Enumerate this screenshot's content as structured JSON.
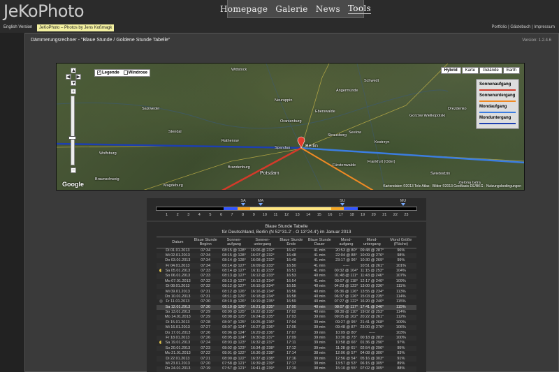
{
  "site": {
    "logo": "JeKoPhoto"
  },
  "nav": {
    "items": [
      {
        "label": "Homepage"
      },
      {
        "label": "Galerie"
      },
      {
        "label": "News"
      },
      {
        "label": "Tools"
      }
    ]
  },
  "subnav": {
    "english": "English Version",
    "tagline": "JeKoPhoto – Photos by Jens Koßmagk",
    "right": "Portfolio | Gästebuch | Impressum"
  },
  "page": {
    "title": "Dämmerungsrechner - \"Blaue Stunde / Goldene Stunde Tabelle\"",
    "version": "Version: 1.2.4.6"
  },
  "map": {
    "legend_toggle": "Legende",
    "windrose_toggle": "Windrose",
    "map_types": [
      "Hybrid",
      "Karte",
      "Gelände",
      "Earth"
    ],
    "active_type": "Hybrid",
    "legend": [
      {
        "label": "Sonnenaufgang",
        "color": "#d43a2a"
      },
      {
        "label": "Sonnenuntergang",
        "color": "#f08a24"
      },
      {
        "label": "Mondaufgang",
        "color": "#3b7de0"
      },
      {
        "label": "Monduntergang",
        "color": "#1d3fb0"
      }
    ],
    "google": "Google",
    "copyright": "Kartendaten ©2013 Tele Atlas · Bilder ©2013 GeoBasis-DE/BKG · Nutzungsbedingungen",
    "places": [
      {
        "name": "Wittstock"
      },
      {
        "name": "Neuruppin"
      },
      {
        "name": "Salzwedel"
      },
      {
        "name": "Stendal"
      },
      {
        "name": "Wolfsburg"
      },
      {
        "name": "Braunschweig"
      },
      {
        "name": "Magdeburg"
      },
      {
        "name": "Brandenburg"
      },
      {
        "name": "Potsdam"
      },
      {
        "name": "Berlin"
      },
      {
        "name": "Eberswalde"
      },
      {
        "name": "Schwedt"
      },
      {
        "name": "Gorzów Wielkopolski"
      },
      {
        "name": "Frankfurt (Oder)"
      },
      {
        "name": "Oranienburg"
      },
      {
        "name": "Rathenow"
      },
      {
        "name": "Spandau"
      },
      {
        "name": "Angermünde"
      },
      {
        "name": "Drezdenko"
      },
      {
        "name": "Świebodzin"
      },
      {
        "name": "Zielona Góra"
      },
      {
        "name": "Kostrzyn"
      },
      {
        "name": "Seelow"
      },
      {
        "name": "Strausberg"
      },
      {
        "name": "Fürstenwalde"
      }
    ]
  },
  "timeline": {
    "hours": [
      "1",
      "2",
      "3",
      "4",
      "5",
      "6",
      "7",
      "8",
      "9",
      "10",
      "11",
      "12",
      "13",
      "14",
      "15",
      "16",
      "17",
      "18",
      "19",
      "20",
      "21",
      "22",
      "23"
    ],
    "events": [
      {
        "label": "SA"
      },
      {
        "label": "MA"
      },
      {
        "label": "SU"
      },
      {
        "label": "MU"
      }
    ]
  },
  "table": {
    "title": "Blaue Stunde Tabelle",
    "subtitle": "für Deutschland, Berlin (N 52°31.2' - O 13°24.4') im Januar 2013",
    "headers": [
      "",
      "Datum",
      "Blaue Stunde Beginn",
      "Sonnen-aufgang",
      "Sonnen-untergang",
      "Blaue Stunde Ende",
      "Blaue Stunde Dauer",
      "Mond-aufgang",
      "Mond-untergang",
      "Mond Größe (Fläche)"
    ],
    "rows": [
      {
        "m": "",
        "d": "Di 01.01.2013",
        "b": "07:34",
        "sa": "08:15 @ 128°",
        "su": "16:06 @ 232°",
        "e": "16:47",
        "du": "41 min",
        "ma": "20:53 @ 80°",
        "mu": "09:48 @ 287°",
        "g": "96%"
      },
      {
        "m": "",
        "d": "Mi 02.01.2013",
        "b": "07:34",
        "sa": "08:15 @ 128°",
        "su": "16:07 @ 232°",
        "e": "16:48",
        "du": "41 min",
        "ma": "22:04 @ 88°",
        "mu": "10:09 @ 276°",
        "g": "98%"
      },
      {
        "m": "",
        "d": "Do 03.01.2013",
        "b": "07:34",
        "sa": "08:14 @ 128°",
        "su": "16:08 @ 232°",
        "e": "16:49",
        "du": "41 min",
        "ma": "23:17 @ 96°",
        "mu": "10:30 @ 269°",
        "g": "99%"
      },
      {
        "m": "",
        "d": "Fr 04.01.2013",
        "b": "07:34",
        "sa": "08:14 @ 127°",
        "su": "16:09 @ 233°",
        "e": "16:50",
        "du": "41 min",
        "ma": "-----",
        "mu": "10:51 @ 261°",
        "g": "101%"
      },
      {
        "m": "half",
        "d": "Sa 05.01.2013",
        "b": "07:33",
        "sa": "08:14 @ 127°",
        "su": "16:11 @ 233°",
        "e": "16:51",
        "du": "41 min",
        "ma": "00:32 @ 104°",
        "mu": "11:15 @ 253°",
        "g": "104%"
      },
      {
        "m": "",
        "d": "So 06.01.2013",
        "b": "07:33",
        "sa": "08:13 @ 127°",
        "su": "16:12 @ 233°",
        "e": "16:53",
        "du": "40 min",
        "ma": "01:48 @ 111°",
        "mu": "11:43 @ 246°",
        "g": "107%"
      },
      {
        "m": "",
        "d": "Mo 07.01.2013",
        "b": "07:32",
        "sa": "08:13 @ 127°",
        "su": "16:13 @ 234°",
        "e": "16:54",
        "du": "41 min",
        "ma": "03:07 @ 118°",
        "mu": "12:17 @ 240°",
        "g": "109%"
      },
      {
        "m": "",
        "d": "Di 08.01.2013",
        "b": "07:32",
        "sa": "08:12 @ 127°",
        "su": "16:15 @ 234°",
        "e": "16:55",
        "du": "40 min",
        "ma": "04:23 @ 123°",
        "mu": "13:00 @ 236°",
        "g": "111%"
      },
      {
        "m": "",
        "d": "Mi 09.01.2013",
        "b": "07:31",
        "sa": "08:12 @ 126°",
        "su": "16:16 @ 234°",
        "e": "16:56",
        "du": "40 min",
        "ma": "05:36 @ 126°",
        "mu": "13:55 @ 234°",
        "g": "113%"
      },
      {
        "m": "",
        "d": "Do 10.01.2013",
        "b": "07:31",
        "sa": "08:11 @ 126°",
        "su": "16:18 @ 234°",
        "e": "16:58",
        "du": "40 min",
        "ma": "06:37 @ 126°",
        "mu": "15:03 @ 235°",
        "g": "114%"
      },
      {
        "m": "new",
        "d": "Fr 11.01.2013",
        "b": "07:30",
        "sa": "08:10 @ 126°",
        "su": "16:19 @ 235°",
        "e": "16:59",
        "du": "40 min",
        "ma": "07:27 @ 122°",
        "mu": "16:20 @ 240°",
        "g": "115%"
      },
      {
        "m": "",
        "d": "Sa 12.01.2013",
        "b": "07:30",
        "sa": "08:10 @ 126°",
        "su": "16:21 @ 235°",
        "e": "17:00",
        "du": "40 min",
        "ma": "08:07 @ 117°",
        "mu": "17:41 @ 246°",
        "g": "115%",
        "hl": true
      },
      {
        "m": "",
        "d": "So 13.01.2013",
        "b": "07:29",
        "sa": "08:09 @ 125°",
        "su": "16:22 @ 235°",
        "e": "17:02",
        "du": "40 min",
        "ma": "08:39 @ 110°",
        "mu": "19:02 @ 253°",
        "g": "114%"
      },
      {
        "m": "",
        "d": "Mo 14.01.2013",
        "b": "07:29",
        "sa": "08:08 @ 125°",
        "su": "16:24 @ 235°",
        "e": "17:03",
        "du": "39 min",
        "ma": "09:05 @ 102°",
        "mu": "20:22 @ 261°",
        "g": "112%"
      },
      {
        "m": "",
        "d": "Di 15.01.2013",
        "b": "07:28",
        "sa": "08:07 @ 125°",
        "su": "16:25 @ 236°",
        "e": "17:04",
        "du": "39 min",
        "ma": "09:27 @ 95°",
        "mu": "21:41 @ 268°",
        "g": "109%"
      },
      {
        "m": "",
        "d": "Mi 16.01.2013",
        "b": "07:27",
        "sa": "08:07 @ 124°",
        "su": "16:27 @ 236°",
        "e": "17:06",
        "du": "39 min",
        "ma": "09:48 @ 87°",
        "mu": "23:00 @ 276°",
        "g": "106%"
      },
      {
        "m": "",
        "d": "Do 17.01.2013",
        "b": "07:26",
        "sa": "08:06 @ 124°",
        "su": "16:29 @ 236°",
        "e": "17:07",
        "du": "39 min",
        "ma": "10:09 @ 80°",
        "mu": "-----",
        "g": "103%"
      },
      {
        "m": "",
        "d": "Fr 18.01.2013",
        "b": "07:26",
        "sa": "08:05 @ 124°",
        "su": "16:30 @ 237°",
        "e": "17:09",
        "du": "39 min",
        "ma": "10:30 @ 73°",
        "mu": "00:18 @ 283°",
        "g": "100%"
      },
      {
        "m": "half",
        "d": "Sa 19.01.2013",
        "b": "07:24",
        "sa": "08:03 @ 123°",
        "su": "16:32 @ 237°",
        "e": "17:11",
        "du": "39 min",
        "ma": "10:58 @ 66°",
        "mu": "01:36 @ 290°",
        "g": "97%"
      },
      {
        "m": "",
        "d": "So 20.01.2013",
        "b": "07:23",
        "sa": "08:02 @ 123°",
        "su": "16:34 @ 238°",
        "e": "17:12",
        "du": "39 min",
        "ma": "11:28 @ 61°",
        "mu": "02:54 @ 296°",
        "g": "95%"
      },
      {
        "m": "",
        "d": "Mo 21.01.2013",
        "b": "07:22",
        "sa": "08:01 @ 122°",
        "su": "16:36 @ 238°",
        "e": "17:14",
        "du": "38 min",
        "ma": "12:06 @ 57°",
        "mu": "04:08 @ 300°",
        "g": "93%"
      },
      {
        "m": "",
        "d": "Di 22.01.2013",
        "b": "07:21",
        "sa": "08:00 @ 122°",
        "su": "16:37 @ 238°",
        "e": "17:16",
        "du": "39 min",
        "ma": "12:56 @ 54°",
        "mu": "05:16 @ 303°",
        "g": "91%"
      },
      {
        "m": "",
        "d": "Mi 23.01.2013",
        "b": "07:20",
        "sa": "07:58 @ 121°",
        "su": "16:39 @ 239°",
        "e": "17:17",
        "du": "38 min",
        "ma": "13:57 @ 53°",
        "mu": "06:15 @ 305°",
        "g": "89%"
      },
      {
        "m": "",
        "d": "Do 24.01.2013",
        "b": "07:19",
        "sa": "07:57 @ 121°",
        "su": "16:41 @ 239°",
        "e": "17:19",
        "du": "38 min",
        "ma": "15:10 @ 55°",
        "mu": "07:02 @ 305°",
        "g": "88%"
      },
      {
        "m": "",
        "d": "Fr 25.01.2013",
        "b": "07:18",
        "sa": "07:56 @ 120°",
        "su": "16:43 @ 240°",
        "e": "17:21",
        "du": "38 min",
        "ma": "16:28 @ 58°",
        "mu": "07:40 @ 302°",
        "g": "87%"
      },
      {
        "m": "",
        "d": "Sa 26.01.2013",
        "b": "07:17",
        "sa": "07:54 @ 120°",
        "su": "16:45 @ 240°",
        "e": "17:22",
        "du": "37 min",
        "ma": "17:49 @ 63°",
        "mu": "08:10 @ 298°",
        "g": "86%"
      }
    ]
  }
}
